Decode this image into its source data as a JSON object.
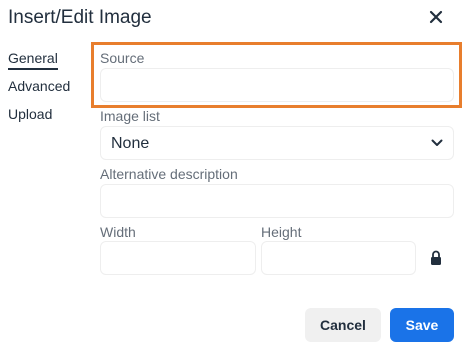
{
  "dialog": {
    "title": "Insert/Edit Image",
    "close_icon": "close-icon"
  },
  "nav": {
    "items": [
      {
        "label": "General",
        "active": true
      },
      {
        "label": "Advanced",
        "active": false
      },
      {
        "label": "Upload",
        "active": false
      }
    ]
  },
  "form": {
    "source": {
      "label": "Source",
      "value": ""
    },
    "image_list": {
      "label": "Image list",
      "selected": "None"
    },
    "alt": {
      "label": "Alternative description",
      "value": ""
    },
    "width": {
      "label": "Width",
      "value": ""
    },
    "height": {
      "label": "Height",
      "value": ""
    },
    "lock_icon": "lock-icon"
  },
  "footer": {
    "cancel_label": "Cancel",
    "save_label": "Save"
  },
  "colors": {
    "accent": "#1a73e8",
    "highlight": "#e87e2d",
    "text": "#222f3e"
  }
}
